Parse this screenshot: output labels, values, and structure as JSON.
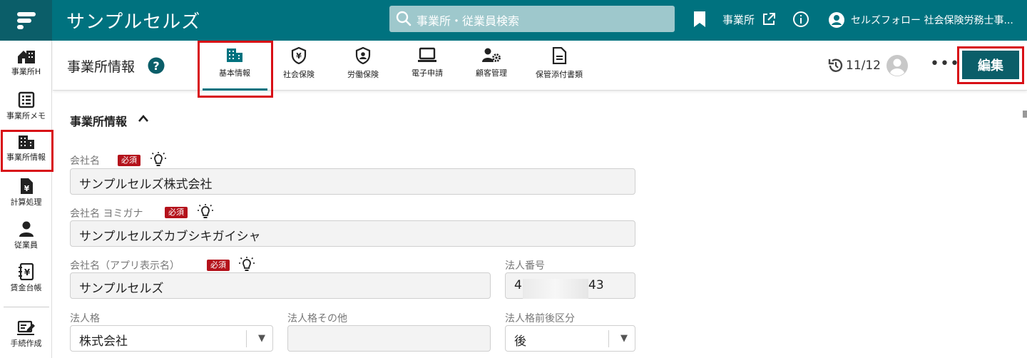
{
  "header": {
    "app_title": "サンプルセルズ",
    "search_placeholder": "事業所・従業員検索",
    "office_link": "事業所",
    "user_label": "セルズフォロー 社会保険労務士事..."
  },
  "sidebar": {
    "items": [
      {
        "label": "事業所H",
        "icon": "office-home-icon"
      },
      {
        "label": "事業所メモ",
        "icon": "memo-list-icon"
      },
      {
        "label": "事業所情報",
        "icon": "building-icon",
        "active": true
      },
      {
        "label": "計算処理",
        "icon": "yen-file-icon"
      },
      {
        "label": "従業員",
        "icon": "person-icon"
      },
      {
        "label": "賃金台帳",
        "icon": "ledger-icon"
      },
      {
        "label": "手続作成",
        "icon": "procedure-edit-icon"
      }
    ]
  },
  "subheader": {
    "title": "事業所情報",
    "tabs": [
      {
        "label": "基本情報",
        "icon": "building-icon",
        "active": true
      },
      {
        "label": "社会保険",
        "icon": "yen-shield-icon"
      },
      {
        "label": "労働保険",
        "icon": "person-shield-icon"
      },
      {
        "label": "電子申請",
        "icon": "laptop-icon"
      },
      {
        "label": "顧客管理",
        "icon": "person-gear-icon"
      },
      {
        "label": "保管添付書類",
        "icon": "document-icon"
      }
    ],
    "history_count": "11/12",
    "more_label": "•••",
    "edit_label": "編集"
  },
  "form": {
    "section_title": "事業所情報",
    "required_badge": "必須",
    "company_name": {
      "label": "会社名",
      "value": "サンプルセルズ株式会社"
    },
    "company_kana": {
      "label": "会社名 ヨミガナ",
      "value": "サンプルセルズカブシキガイシャ"
    },
    "company_app_name": {
      "label": "会社名（アプリ表示名）",
      "value": "サンプルセルズ"
    },
    "corporate_number": {
      "label": "法人番号",
      "value_prefix": "4",
      "value_suffix": "43"
    },
    "corporate_type": {
      "label": "法人格",
      "value": "株式会社"
    },
    "corporate_type_other": {
      "label": "法人格その他",
      "value": ""
    },
    "corporate_position": {
      "label": "法人格前後区分",
      "value": "後"
    }
  },
  "colors": {
    "header": "#00727f",
    "header_dark": "#0b5e69",
    "highlight": "#d80f16",
    "required": "#b4121b"
  }
}
